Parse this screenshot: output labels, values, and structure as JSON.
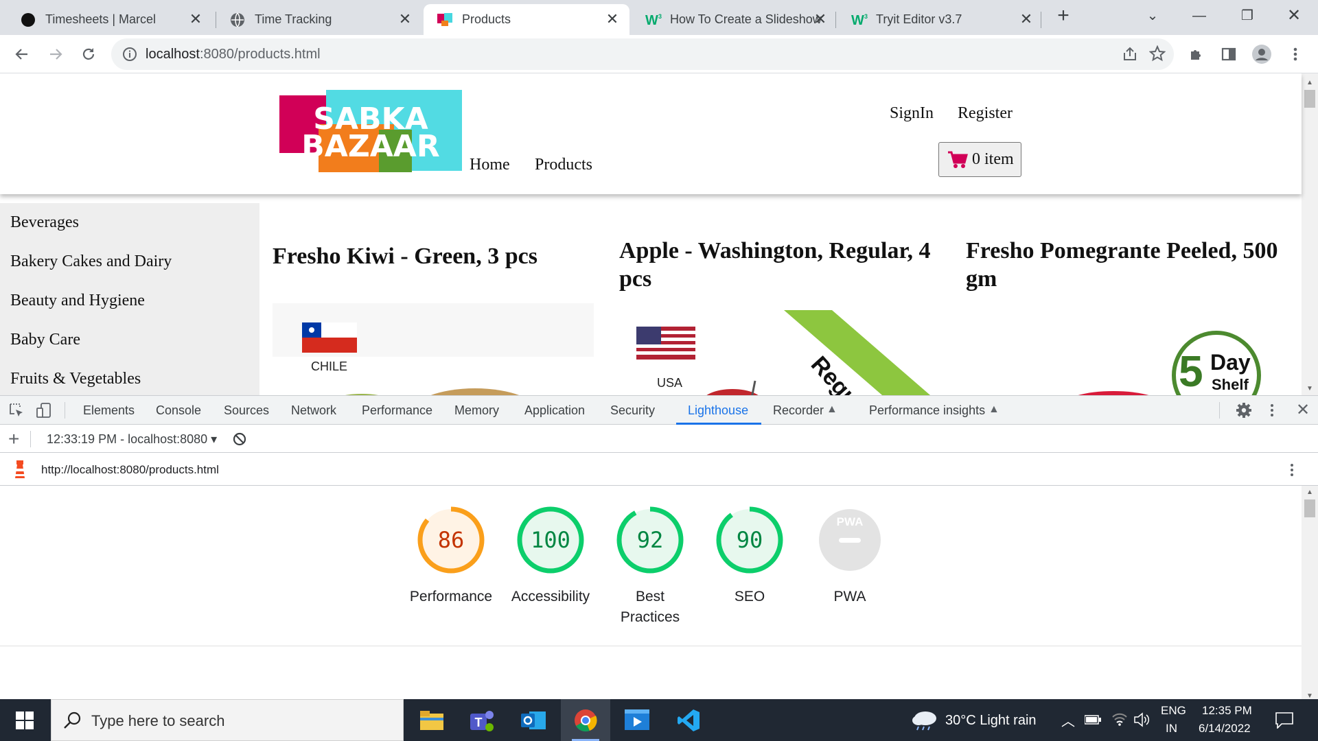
{
  "browser": {
    "tabs": [
      {
        "title": "Timesheets | Marcel",
        "active": false
      },
      {
        "title": "Time Tracking",
        "active": false
      },
      {
        "title": "Products",
        "active": true
      },
      {
        "title": "How To Create a Slideshow",
        "active": false
      },
      {
        "title": "Tryit Editor v3.7",
        "active": false
      }
    ],
    "url_host": "localhost",
    "url_path": ":8080/products.html"
  },
  "site": {
    "logo_line1": "SABKA",
    "logo_line2": "BAZAAR",
    "nav": {
      "home": "Home",
      "products": "Products",
      "signin": "SignIn",
      "register": "Register"
    },
    "cart_label": "0 item",
    "categories": [
      "Beverages",
      "Bakery Cakes and Dairy",
      "Beauty and Hygiene",
      "Baby Care",
      "Fruits & Vegetables"
    ],
    "products": [
      {
        "title": "Fresho Kiwi - Green, 3 pcs",
        "origin": "CHILE"
      },
      {
        "title": "Apple - Washington, Regular, 4 pcs",
        "origin": "USA",
        "ribbon": "Regular"
      },
      {
        "title": "Fresho Pomegrante Peeled, 500 gm",
        "badge_line1": "Day",
        "badge_line2": "Shelf",
        "badge_number": "5"
      }
    ]
  },
  "devtools": {
    "tabs": [
      "Elements",
      "Console",
      "Sources",
      "Network",
      "Performance",
      "Memory",
      "Application",
      "Security",
      "Lighthouse",
      "Recorder",
      "Performance insights"
    ],
    "active_tab": "Lighthouse",
    "report_selector": "12:33:19 PM - localhost:8080",
    "report_url": "http://localhost:8080/products.html",
    "scores": [
      {
        "label": "Performance",
        "value": "86",
        "fraction": 0.86,
        "color": "#fa9f1b",
        "text_color": "#c33300",
        "bg": "#fff3e5"
      },
      {
        "label": "Accessibility",
        "value": "100",
        "fraction": 1.0,
        "color": "#0cce6b",
        "text_color": "#018642",
        "bg": "#e7f8ee"
      },
      {
        "label": "Best Practices",
        "value": "92",
        "fraction": 0.92,
        "color": "#0cce6b",
        "text_color": "#018642",
        "bg": "#e7f8ee"
      },
      {
        "label": "SEO",
        "value": "90",
        "fraction": 0.9,
        "color": "#0cce6b",
        "text_color": "#018642",
        "bg": "#e7f8ee"
      },
      {
        "label": "PWA",
        "value": "PWA",
        "fraction": 0,
        "color": "#cccccc",
        "text_color": "#ffffff",
        "bg": "#e3e3e3"
      }
    ]
  },
  "taskbar": {
    "search_placeholder": "Type here to search",
    "weather": "30°C  Light rain",
    "lang_line1": "ENG",
    "lang_line2": "IN",
    "time": "12:35 PM",
    "date": "6/14/2022"
  }
}
